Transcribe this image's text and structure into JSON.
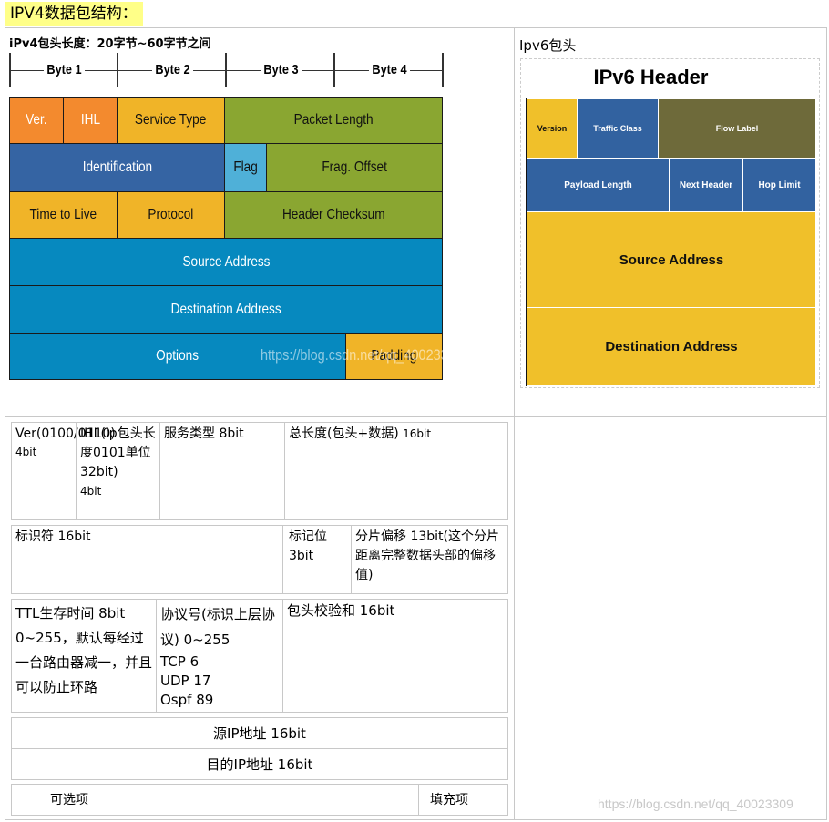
{
  "title": "IPV4数据包结构：",
  "ipv4_subhead": "iPv4包头长度：20字节~60字节之间",
  "ipv6_subhead": "Ipv6包头",
  "ipv4_diagram": {
    "bytes": [
      "Byte 1",
      "Byte 2",
      "Byte 3",
      "Byte 4"
    ],
    "fields": {
      "ver": "Ver.",
      "ihl": "IHL",
      "service_type": "Service Type",
      "packet_length": "Packet Length",
      "identification": "Identification",
      "flag": "Flag",
      "frag_offset": "Frag. Offset",
      "ttl": "Time to Live",
      "protocol": "Protocol",
      "header_checksum": "Header Checksum",
      "source": "Source Address",
      "destination": "Destination Address",
      "options": "Options",
      "padding": "Padding"
    },
    "watermark": "https://blog.csdn.net/qq_40023309",
    "colors": {
      "orange": "#f38a2e",
      "gold": "#f0b428",
      "green": "#8aa631",
      "blue": "#3564a3",
      "light_blue": "#4fb0d8",
      "cyan": "#0689bf"
    }
  },
  "ipv6_diagram": {
    "title": "IPv6 Header",
    "fields": {
      "version": "Version",
      "traffic_class": "Traffic Class",
      "flow_label": "Flow Label",
      "payload_length": "Payload Length",
      "next_header": "Next Header",
      "hop_limit": "Hop Limit",
      "source": "Source Address",
      "destination": "Destination Address"
    }
  },
  "table": {
    "row1": {
      "ver": "Ver(0100/0110)",
      "ver_bits": "4bit",
      "ihl": "IHL(ip包头长度0101单位32bit)",
      "ihl_bits": "4bit",
      "service": "服务类型 8bit",
      "total_len": "总长度(包头+数据)",
      "total_len_bits": "16bit"
    },
    "row2": {
      "ident": "标识符 16bit",
      "flag": "标记位3bit",
      "frag": "分片偏移 13bit(这个分片距离完整数据头部的偏移值)"
    },
    "row3": {
      "ttl": "TTL生存时间 8bit 0~255，默认每经过一台路由器减一，并且可以防止环路",
      "proto": "协议号(标识上层协议) 0~255",
      "proto_tcp": "TCP 6",
      "proto_udp": "UDP 17",
      "proto_ospf": "Ospf 89",
      "checksum": "包头校验和 16bit"
    },
    "row4": {
      "src": "源IP地址 16bit"
    },
    "row5": {
      "dst": "目的IP地址 16bit"
    },
    "row6": {
      "options": "可选项",
      "padding": "填充项"
    }
  },
  "footer_watermark": "https://blog.csdn.net/qq_40023309"
}
